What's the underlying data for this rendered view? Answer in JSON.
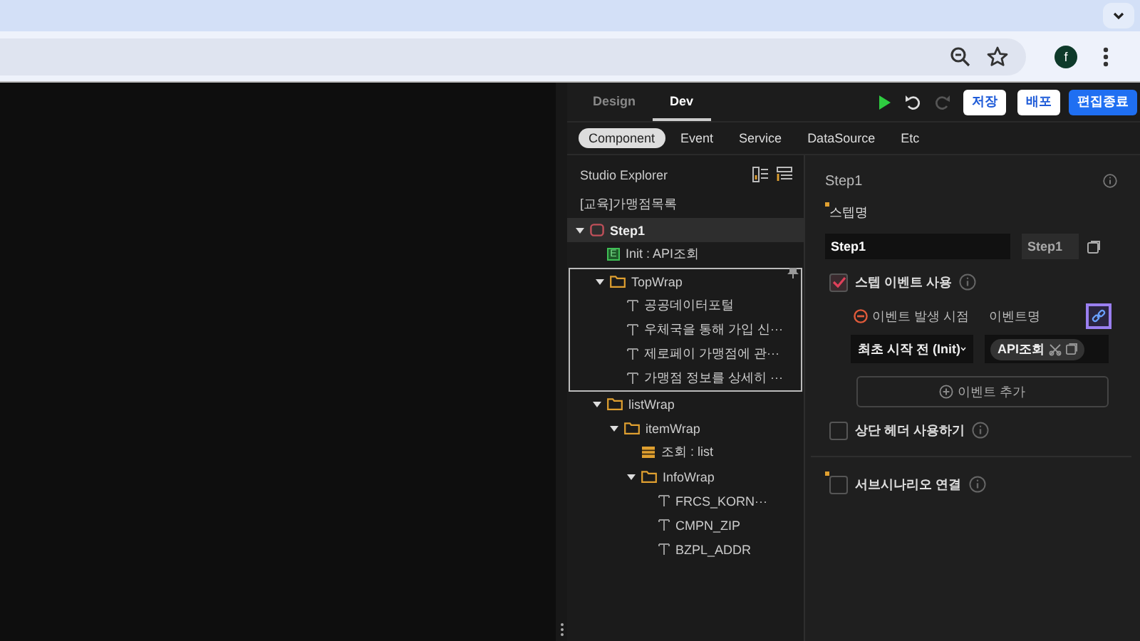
{
  "browser": {
    "avatar": "f"
  },
  "tabs": [
    {
      "label": "Design",
      "selected": false
    },
    {
      "label": "Dev",
      "selected": true
    }
  ],
  "toolbar": {
    "redo_disabled": true,
    "buttons": [
      {
        "label": "저장",
        "kind": "plain"
      },
      {
        "label": "배포",
        "kind": "plain"
      },
      {
        "label": "편집종료",
        "kind": "primary"
      }
    ]
  },
  "subtabs": [
    {
      "label": "Component",
      "selected": true
    },
    {
      "label": "Event",
      "selected": false
    },
    {
      "label": "Service",
      "selected": false
    },
    {
      "label": "DataSource",
      "selected": false
    },
    {
      "label": "Etc",
      "selected": false
    }
  ],
  "explorer": {
    "title": "Studio Explorer",
    "project": "[교육]가맹점목록",
    "tree": [
      {
        "label": "Step1",
        "kind": "screen",
        "expanded": true,
        "selected": true,
        "outlined": false,
        "children": [
          {
            "label": "Init : API조회",
            "kind": "event",
            "badge": "E",
            "selected": false,
            "outlined": false
          },
          {
            "label": "TopWrap",
            "kind": "folder",
            "expanded": true,
            "selected": false,
            "outlined": true,
            "children": [
              {
                "label": "공공데이터포털",
                "kind": "text",
                "selected": false,
                "outlined": false
              },
              {
                "label": "우체국을 통해 가입 신···",
                "kind": "text",
                "selected": false,
                "outlined": false
              },
              {
                "label": "제로페이 가맹점에 관···",
                "kind": "text",
                "selected": false,
                "outlined": false
              },
              {
                "label": "가맹점 정보를 상세히 ···",
                "kind": "text",
                "selected": false,
                "outlined": false
              }
            ]
          },
          {
            "label": "listWrap",
            "kind": "folder",
            "expanded": true,
            "selected": false,
            "outlined": false,
            "children": [
              {
                "label": "itemWrap",
                "kind": "folder",
                "expanded": true,
                "selected": false,
                "outlined": false,
                "children": [
                  {
                    "label": "조회 : list",
                    "kind": "data",
                    "selected": false,
                    "outlined": false
                  },
                  {
                    "label": "InfoWrap",
                    "kind": "folder",
                    "expanded": true,
                    "selected": false,
                    "outlined": false,
                    "children": [
                      {
                        "label": "FRCS_KORN···",
                        "kind": "text",
                        "selected": false,
                        "outlined": false
                      },
                      {
                        "label": "CMPN_ZIP",
                        "kind": "text",
                        "selected": false,
                        "outlined": false
                      },
                      {
                        "label": "BZPL_ADDR",
                        "kind": "text",
                        "selected": false,
                        "outlined": false
                      }
                    ]
                  }
                ]
              }
            ]
          }
        ]
      }
    ]
  },
  "properties": {
    "title": "Step1",
    "name_label": "스텝명",
    "name_required": true,
    "name_value": "Step1",
    "name_code": "Step1",
    "use_event": {
      "label": "스텝 이벤트 사용",
      "checked": true
    },
    "event_columns": [
      "이벤트 발생 시점",
      "이벤트명"
    ],
    "link_active": true,
    "events": [
      {
        "timing": "최초 시작 전 (Init)",
        "name": "API조회"
      }
    ],
    "add_event": "이벤트 추가",
    "header": {
      "label": "상단 헤더 사용하기",
      "checked": false
    },
    "subscenario": {
      "label": "서브시나리오 연결",
      "checked": false,
      "required": true
    }
  }
}
